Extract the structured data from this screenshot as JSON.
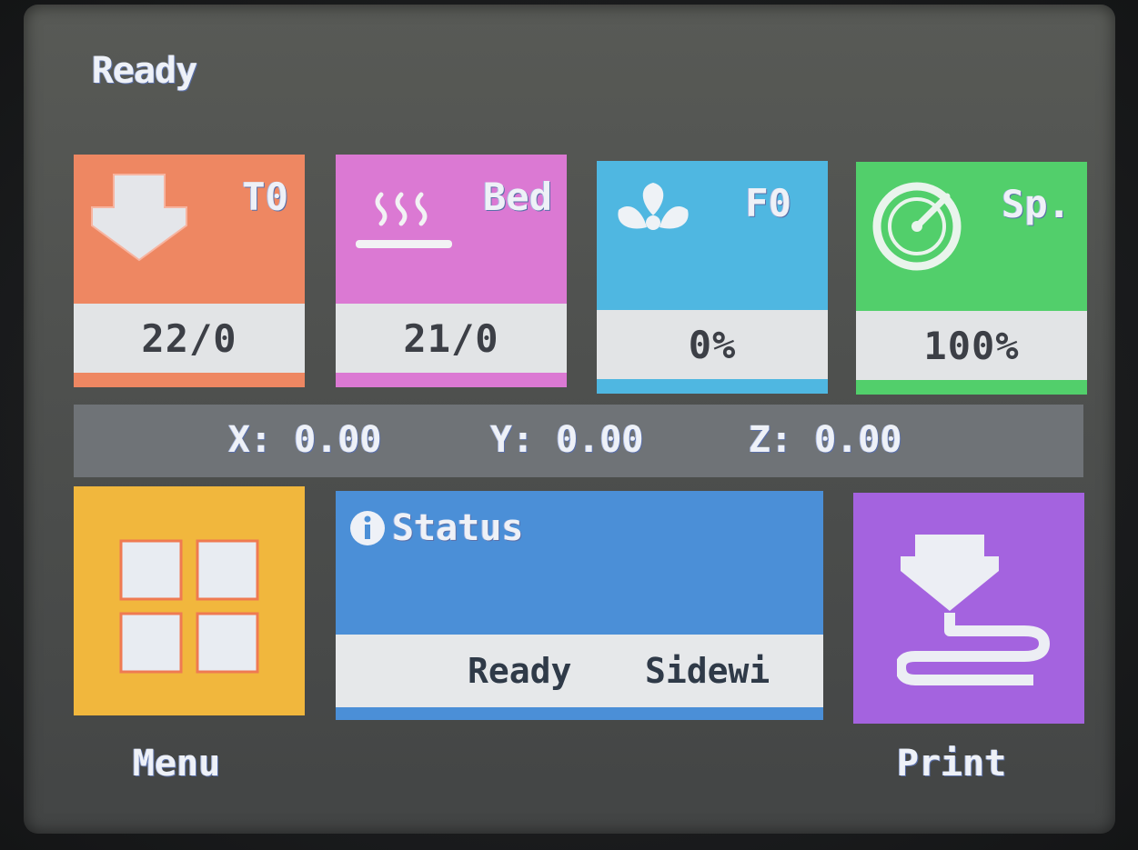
{
  "status": {
    "title": "Ready"
  },
  "tiles": {
    "hotend": {
      "label": "T0",
      "value": "22/0",
      "color": "#ee8762",
      "icon": "nozzle-icon"
    },
    "bed": {
      "label": "Bed",
      "value": "21/0",
      "color": "#db79d3",
      "icon": "bed-heat-icon"
    },
    "fan": {
      "label": "F0",
      "value": "0%",
      "color": "#4fb7e1",
      "icon": "fan-icon"
    },
    "speed": {
      "label": "Sp.",
      "value": "100%",
      "color": "#52cf6b",
      "icon": "speedometer-icon"
    }
  },
  "coordinates": {
    "x": "X: 0.00",
    "y": "Y: 0.00",
    "z": "Z: 0.00"
  },
  "status_panel": {
    "title": "Status",
    "message_1": "Ready",
    "message_2": "Sidewi",
    "color": "#4b8fd7",
    "icon": "info-icon"
  },
  "menu": {
    "label": "Menu",
    "color": "#f1b73d",
    "icon": "grid-icon"
  },
  "print": {
    "label": "Print",
    "color": "#a463df",
    "icon": "print-icon"
  }
}
